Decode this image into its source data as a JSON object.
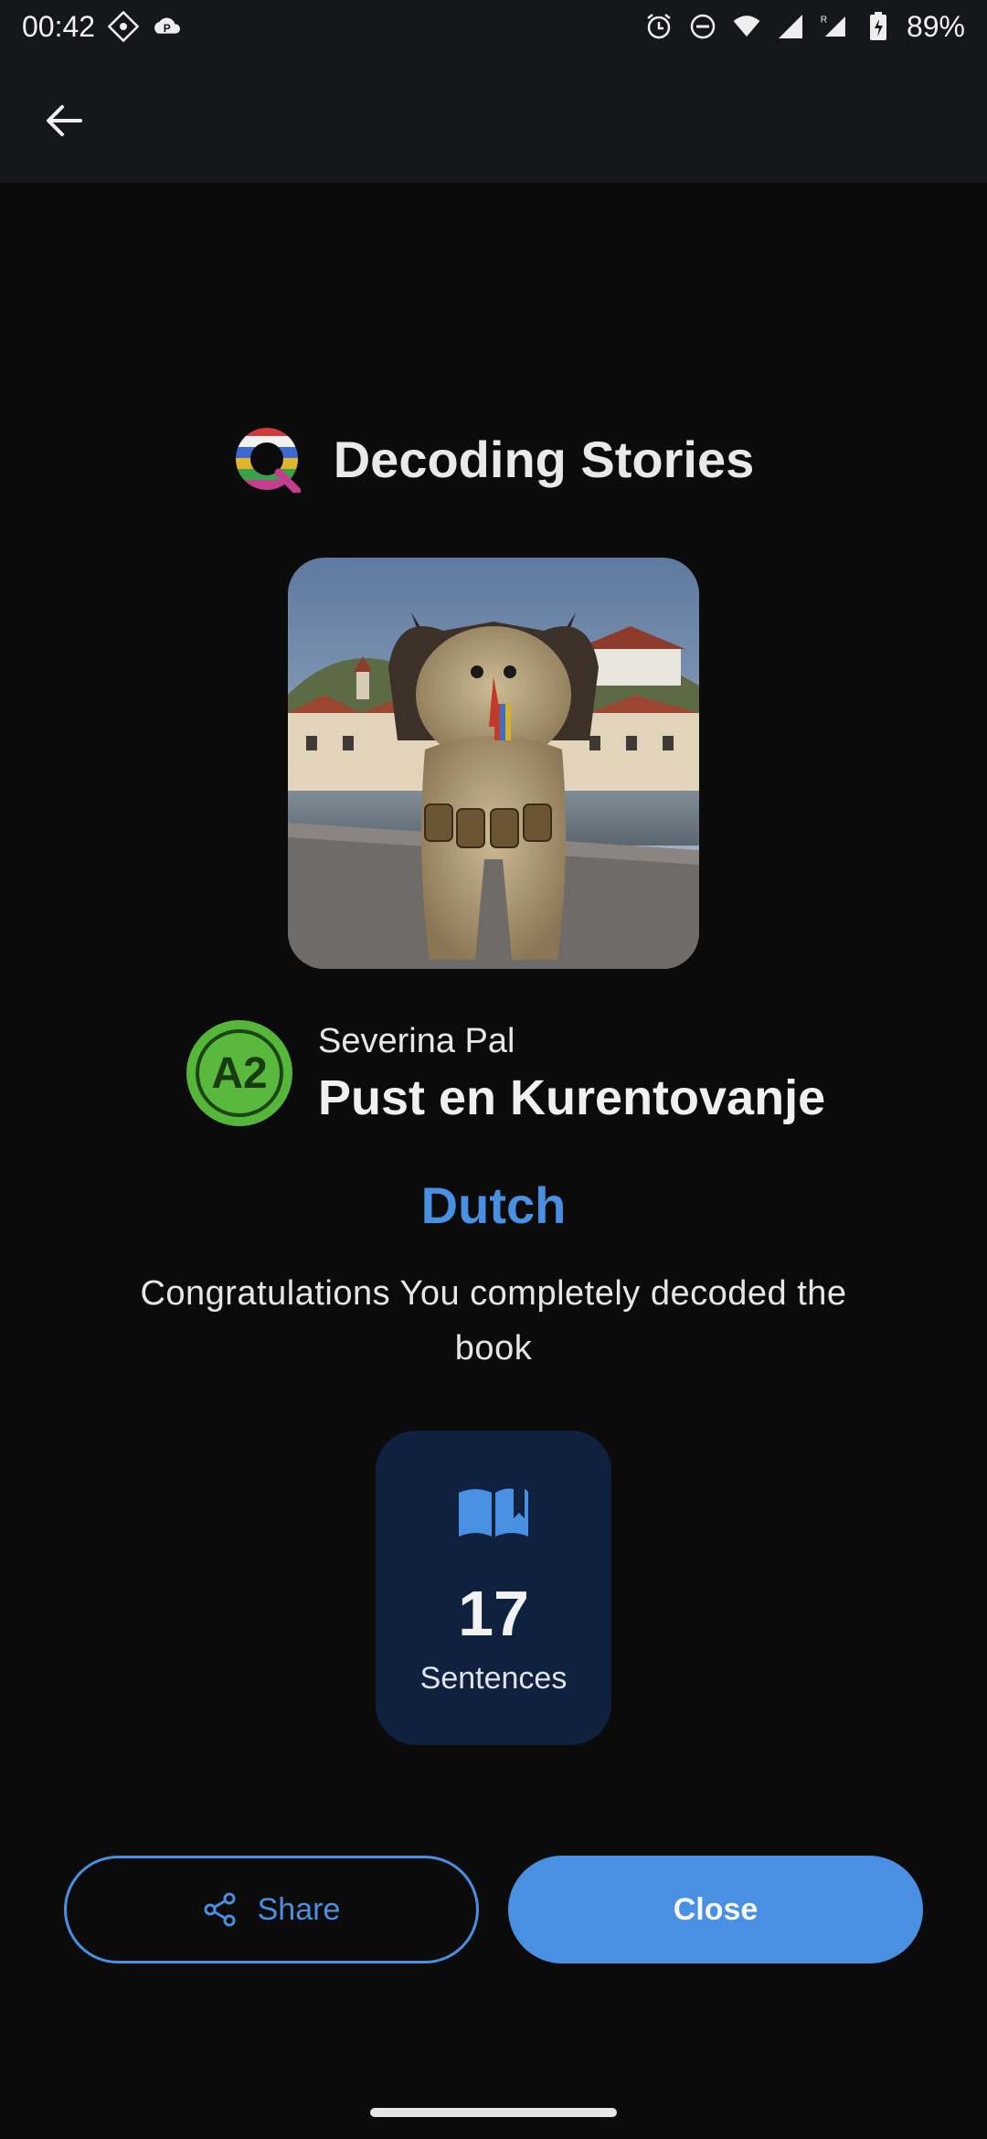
{
  "status_bar": {
    "time": "00:42",
    "battery": "89%",
    "icons": [
      "grid-icon",
      "parking-cloud-icon",
      "alarm-icon",
      "dnd-icon",
      "wifi-icon",
      "signal-icon",
      "signal-roaming-icon",
      "battery-icon"
    ]
  },
  "header": {
    "app_name": "Decoding Stories"
  },
  "book": {
    "level": "A2",
    "author": "Severina Pal",
    "title": "Pust en Kurentovanje",
    "language": "Dutch"
  },
  "result": {
    "message": "Congratulations You completely decoded the book"
  },
  "stats": {
    "value": "17",
    "label": "Sentences"
  },
  "actions": {
    "share_label": "Share",
    "close_label": "Close"
  },
  "colors": {
    "background": "#0b0b0c",
    "bar": "#15171b",
    "accent": "#4a90e2",
    "card": "#10213f",
    "level_badge": "#56b63a"
  }
}
